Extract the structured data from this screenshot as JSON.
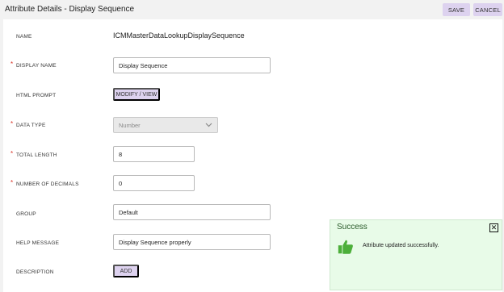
{
  "header": {
    "title": "Attribute Details - Display Sequence",
    "save_label": "SAVE",
    "cancel_label": "CANCEL"
  },
  "fields": {
    "name": {
      "label": "NAME",
      "value": "ICMMasterDataLookupDisplaySequence"
    },
    "display_name": {
      "label": "DISPLAY NAME",
      "required": "*",
      "value": "Display Sequence"
    },
    "html_prompt": {
      "label": "HTML PROMPT",
      "button": "MODIFY / VIEW"
    },
    "data_type": {
      "label": "DATA TYPE",
      "required": "*",
      "value": "Number"
    },
    "total_length": {
      "label": "TOTAL LENGTH",
      "required": "*",
      "value": "8"
    },
    "number_of_decimals": {
      "label": "NUMBER OF DECIMALS",
      "required": "*",
      "value": "0"
    },
    "group": {
      "label": "GROUP",
      "value": "Default"
    },
    "help_message": {
      "label": "HELP MESSAGE",
      "value": "Display Sequence properly"
    },
    "description": {
      "label": "DESCRIPTION",
      "button": "ADD"
    }
  },
  "toast": {
    "title": "Success",
    "message": "Attribute updated successfully.",
    "close_glyph": "✕"
  },
  "colors": {
    "accent_button": "#ddd2ef",
    "required": "#d93025",
    "toast_bg": "#e8fbe8",
    "thumb": "#4caf3a"
  }
}
